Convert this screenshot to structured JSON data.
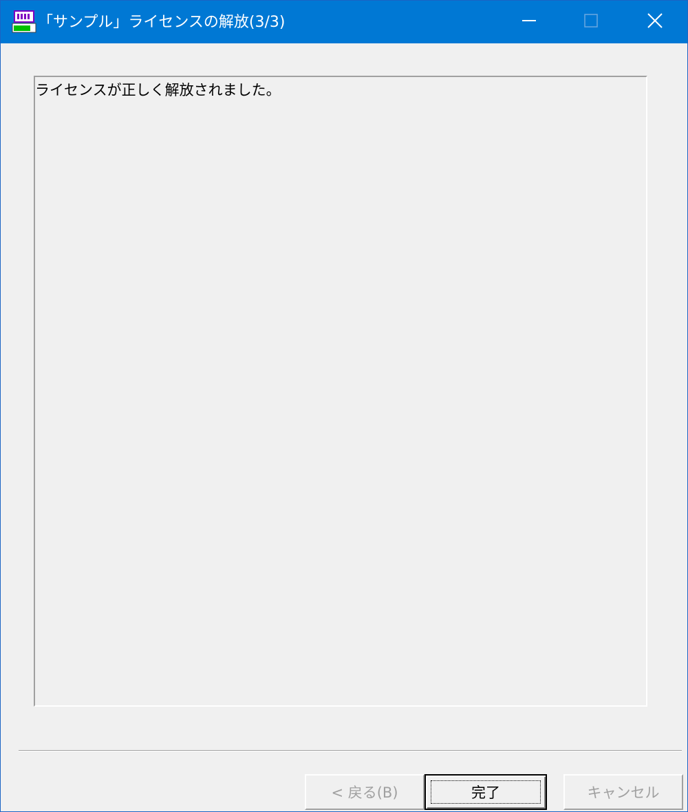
{
  "window": {
    "title": "「サンプル」ライセンスの解放(3/3)",
    "icon": "app-icon",
    "controls": {
      "minimize_icon": "minimize-icon",
      "maximize_icon": "maximize-icon",
      "close_icon": "close-icon"
    },
    "accent_color": "#0078d4"
  },
  "main": {
    "message": "ライセンスが正しく解放されました。"
  },
  "footer": {
    "back_label": "< 戻る(B)",
    "back_enabled": false,
    "finish_label": "完了",
    "finish_default": true,
    "cancel_label": "キャンセル",
    "cancel_enabled": false
  }
}
